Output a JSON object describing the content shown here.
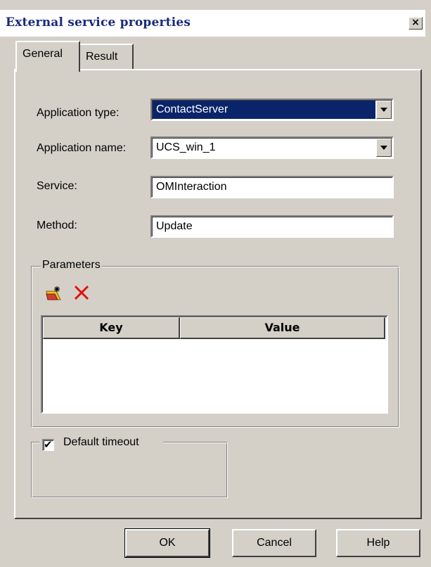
{
  "window": {
    "title": "External service properties",
    "close_glyph": "×"
  },
  "tabs": [
    {
      "label": "General",
      "active": true
    },
    {
      "label": "Result",
      "active": false
    }
  ],
  "form": {
    "application_type": {
      "label": "Application type:",
      "value": "ContactServer"
    },
    "application_name": {
      "label": "Application name:",
      "value": "UCS_win_1"
    },
    "service": {
      "label": "Service:",
      "value": "OMInteraction"
    },
    "method": {
      "label": "Method:",
      "value": "Update"
    }
  },
  "parameters": {
    "legend": "Parameters",
    "toolbar": {
      "new_icon": "new-parameter-icon",
      "delete_icon": "delete-parameter-icon"
    },
    "columns": [
      "Key",
      "Value"
    ],
    "rows": []
  },
  "timeout": {
    "label": "Default timeout",
    "checked": true,
    "check_glyph": "✔"
  },
  "buttons": {
    "ok": "OK",
    "cancel": "Cancel",
    "help": "Help"
  },
  "colors": {
    "selection": "#0a246a",
    "title_text": "#1a2a7a",
    "face": "#d4d0c8",
    "delete_red": "#e01010"
  }
}
